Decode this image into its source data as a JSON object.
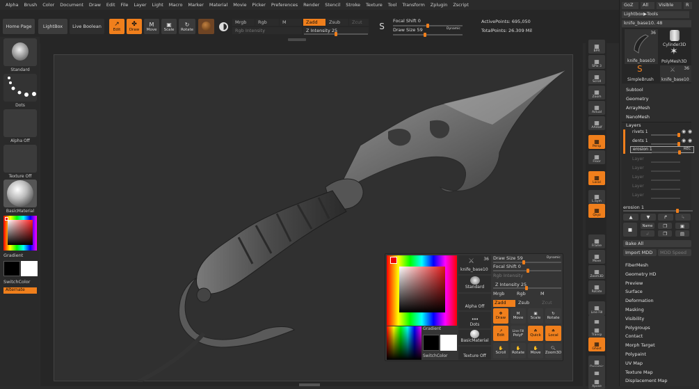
{
  "menu": [
    "Alpha",
    "Brush",
    "Color",
    "Document",
    "Draw",
    "Edit",
    "File",
    "Layer",
    "Light",
    "Macro",
    "Marker",
    "Material",
    "Movie",
    "Picker",
    "Preferences",
    "Render",
    "Stencil",
    "Stroke",
    "Texture",
    "Tool",
    "Transform",
    "Zplugin",
    "Zscript"
  ],
  "shelf": {
    "home_page": "Home Page",
    "lightbox": "LightBox",
    "live_boolean": "Live Boolean",
    "edit": "Edit",
    "draw": "Draw",
    "move": "Move",
    "scale": "Scale",
    "rotate": "Rotate",
    "mrgb": "Mrgb",
    "rgb": "Rgb",
    "m": "M",
    "rgb_intensity": "Rgb Intensity",
    "zadd": "Zadd",
    "zsub": "Zsub",
    "zcut": "Zcut",
    "z_intensity": "Z Intensity 25",
    "focal_shift": "Focal Shift 0",
    "draw_size": "Draw Size 59",
    "dynamic": "Dynamic",
    "active_points": "ActivePoints: 695,050",
    "total_points": "TotalPoints: 26.309 Mil"
  },
  "left": {
    "brush": "Standard",
    "stroke": "Dots",
    "alpha": "Alpha Off",
    "texture": "Texture Off",
    "material": "BasicMaterial",
    "gradient": "Gradient",
    "switch_color": "SwitchColor",
    "alternate": "Alternate"
  },
  "right_shelf": [
    "BPR",
    "SPix 3",
    "Scroll",
    "Zoom",
    "Actual",
    "AAHalf",
    "Persp",
    "Floor",
    "Local",
    "L.Sym",
    "Qxyz",
    "Frame",
    "Move",
    "Zoom3D",
    "Rotate",
    "Line Fill",
    "PolyF",
    "Transp",
    "Ghost",
    "Dynamic",
    "Solo",
    "Xpose"
  ],
  "tray": {
    "goz": "GoZ",
    "all": "All",
    "visible": "Visible",
    "r": "R",
    "lightbox_tools": "Lightbox▶Tools",
    "current_tool": "knife_base10. 48",
    "tools": [
      {
        "name": "knife_base10",
        "count": "36"
      },
      {
        "name": "Cylinder3D",
        "count": ""
      },
      {
        "name": "PolyMesh3D",
        "count": ""
      },
      {
        "name": "SimpleBrush",
        "count": ""
      },
      {
        "name": "knife_base10",
        "count": "36"
      }
    ],
    "subpalettes": [
      "Subtool",
      "Geometry",
      "ArrayMesh",
      "NanoMesh"
    ],
    "layers_title": "Layers",
    "layers": [
      "rivets 1",
      "dents 1",
      "erosion 1"
    ],
    "rec": "REC",
    "empty_layer": "Layer",
    "erosion_slider": "erosion 1",
    "name_btn": "Name",
    "bake_all": "Bake All",
    "import_mdd": "Import MDD",
    "mdd_speed": "MDD Speed",
    "more": [
      "FiberMesh",
      "Geometry HD",
      "Preview",
      "Surface",
      "Deformation",
      "Masking",
      "Visibility",
      "Polygroups",
      "Contact",
      "Morph Target",
      "Polypaint",
      "UV Map",
      "Texture Map",
      "Displacement Map"
    ]
  },
  "popup": {
    "count": "36",
    "tool_name": "knife_base10",
    "brush": "Standard",
    "alpha": "Alpha Off",
    "stroke": "Dots",
    "material": "BasicMaterial",
    "texture": "Texture Off",
    "gradient": "Gradient",
    "switch_color": "SwitchColor",
    "draw_size": "Draw Size 59",
    "dynamic": "Dynamic",
    "focal_shift": "Focal Shift 0",
    "rgb_intensity": "Rgb Intensity",
    "z_intensity": "Z Intensity 25",
    "mrgb": "Mrgb",
    "rgb": "Rgb",
    "m": "M",
    "zadd": "Zadd",
    "zsub": "Zsub",
    "zcut": "Zcut",
    "draw": "Draw",
    "move": "Move",
    "scale": "Scale",
    "rotate": "Rotate",
    "edit": "Edit",
    "linefill": "Line Fill",
    "polyf": "PolyF",
    "quick": "Quick",
    "local": "Local",
    "scroll": "Scroll",
    "zoom3d": "Zoom3D"
  }
}
